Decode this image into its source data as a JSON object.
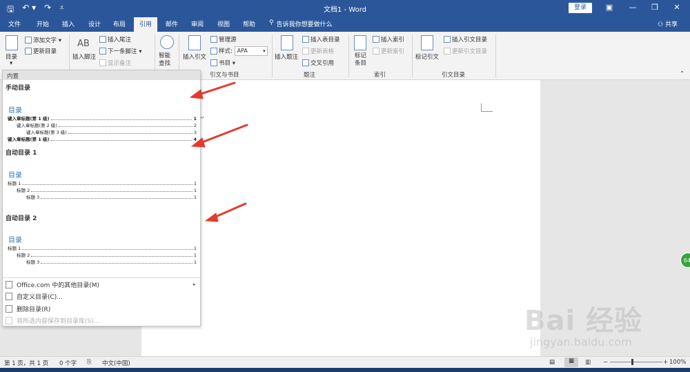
{
  "titlebar": {
    "document_title": "文档1 - Word",
    "login_label": "登录",
    "save_icon": "save-icon",
    "undo_icon": "undo-icon",
    "redo_icon": "redo-icon",
    "customize_icon": "customize-qat-icon"
  },
  "tabs": {
    "items": [
      "文件",
      "开始",
      "插入",
      "设计",
      "布局",
      "引用",
      "邮件",
      "审阅",
      "视图",
      "帮助"
    ],
    "active": "引用",
    "tell_me": "告诉我你想要做什么",
    "share": "共享"
  },
  "ribbon": {
    "toc": {
      "label": "目录",
      "add_text": "添加文字",
      "update_toc": "更新目录"
    },
    "footnotes": {
      "insert_footnote": "插入脚注",
      "insert_endnote": "插入尾注",
      "next_footnote": "下一条脚注",
      "show_notes": "显示备注",
      "icon_text": "AB"
    },
    "research": {
      "smart_lookup": "智能查找"
    },
    "citations": {
      "insert_citation": "插入引文",
      "manage_sources": "管理源",
      "style_label": "样式:",
      "style_value": "APA",
      "bibliography": "书目",
      "group_label": "引文与书目"
    },
    "captions": {
      "insert_caption": "插入题注",
      "insert_table_of_figures": "插入表目录",
      "update_table": "更新表格",
      "cross_reference": "交叉引用",
      "group_label": "题注"
    },
    "index": {
      "mark_entry": "标记条目",
      "insert_index": "插入索引",
      "update_index": "更新索引",
      "group_label": "索引"
    },
    "toa": {
      "mark_citation": "标记引文",
      "insert_toa": "插入引文目录",
      "update_toa": "更新引文目录",
      "group_label": "引文目录"
    }
  },
  "dropdown": {
    "header": "内置",
    "manual_title": "手动目录",
    "manual_heading": "目录",
    "manual_lines": [
      {
        "text": "键入章标题(第 1 级)",
        "page": "1"
      },
      {
        "text": "键入章标题(第 2 级)",
        "page": "2"
      },
      {
        "text": "键入章标题(第 3 级)",
        "page": "3"
      },
      {
        "text": "键入章标题(第 1 级)",
        "page": "4"
      }
    ],
    "auto1_title": "自动目录 1",
    "auto1_heading": "目录",
    "auto1_lines": [
      {
        "text": "标题 1",
        "page": "1"
      },
      {
        "text": "标题 2",
        "page": "1"
      },
      {
        "text": "标题 3",
        "page": "1"
      }
    ],
    "auto2_title": "自动目录 2",
    "auto2_heading": "目录",
    "auto2_lines": [
      {
        "text": "标题 1",
        "page": "1"
      },
      {
        "text": "标题 2",
        "page": "1"
      },
      {
        "text": "标题 3",
        "page": "1"
      }
    ],
    "menu": {
      "more_office": "Office.com 中的其他目录(M)",
      "custom_toc": "自定义目录(C)...",
      "remove_toc": "删除目录(R)",
      "save_selection": "将所选内容保存到目录库(S)..."
    }
  },
  "statusbar": {
    "page_info": "第 1 页，共 1 页",
    "word_count": "0 个字",
    "language": "中文(中国)",
    "zoom": "100%",
    "zoom_level": 1.0
  },
  "badge": "64",
  "watermark": {
    "main": "Bai 经验",
    "sub": "jingyan.baidu.com"
  },
  "colors": {
    "title_bar": "#2b579a",
    "toc_heading": "#2e74b5",
    "arrow": "#e23b2e",
    "badge": "#38a43c"
  }
}
